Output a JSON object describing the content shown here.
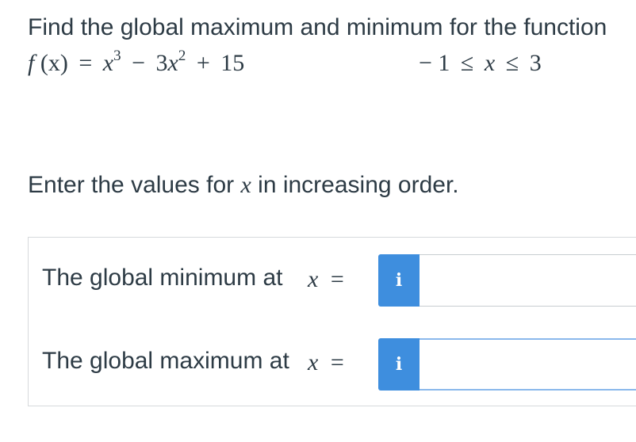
{
  "question": {
    "prompt": "Find the global maximum and minimum for the function",
    "function": {
      "lhs_name": "f",
      "lhs_arg": "(x)",
      "equals": "=",
      "term1_base": "x",
      "term1_exp": "3",
      "minus": "−",
      "term2_coef": "3",
      "term2_base": "x",
      "term2_exp": "2",
      "plus": "+",
      "constant": "15"
    },
    "domain": {
      "lower": "− 1",
      "leq1": "≤",
      "var": "x",
      "leq2": "≤",
      "upper": "3"
    },
    "instruction_before": "Enter the values for ",
    "instruction_var": "x",
    "instruction_after": " in increasing order."
  },
  "answers": {
    "rows": [
      {
        "label": "The global minimum at",
        "var": "x",
        "equals": "=",
        "info_icon": "i",
        "value": "",
        "placeholder": ""
      },
      {
        "label": "The global maximum at",
        "var": "x",
        "equals": "=",
        "info_icon": "i",
        "value": "",
        "placeholder": ""
      }
    ]
  },
  "colors": {
    "text": "#2d3b45",
    "info_button": "#3e8ede",
    "border": "#d6d9dc",
    "focus_border": "#8ab8ec"
  }
}
